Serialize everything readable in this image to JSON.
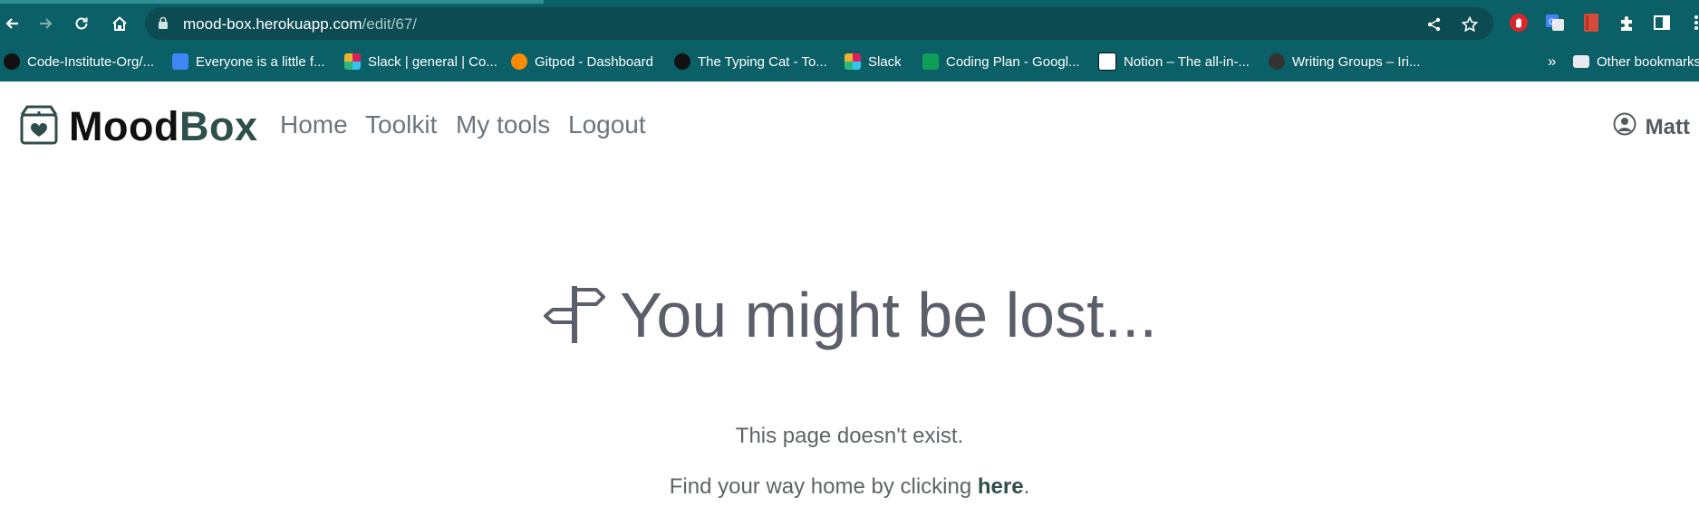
{
  "browser": {
    "url_host": "mood-box.herokuapp.com",
    "url_path": "/edit/67/",
    "bookmarks": [
      {
        "label": "Code-Institute-Org/...",
        "icon": "github-icon"
      },
      {
        "label": "Everyone is a little f...",
        "icon": "google-docs-icon"
      },
      {
        "label": "Slack | general | Co...",
        "icon": "slack-icon"
      },
      {
        "label": "Gitpod - Dashboard",
        "icon": "gitpod-icon"
      },
      {
        "label": "The Typing Cat - To...",
        "icon": "paw-icon"
      },
      {
        "label": "Slack",
        "icon": "slack-icon"
      },
      {
        "label": "Coding Plan - Googl...",
        "icon": "google-sheets-icon"
      },
      {
        "label": "Notion – The all-in-...",
        "icon": "notion-icon"
      },
      {
        "label": "Writing Groups – Iri...",
        "icon": "writing-icon"
      }
    ],
    "overflow_label": "»",
    "other_bookmarks": "Other bookmarks"
  },
  "site": {
    "brand_part1": "Mood",
    "brand_part2": "Box",
    "nav": [
      "Home",
      "Toolkit",
      "My tools",
      "Logout"
    ],
    "user_name": "Matt"
  },
  "content": {
    "headline": "You might be lost...",
    "message": "This page doesn't exist.",
    "link_prefix": "Find your way home by clicking ",
    "link_text": "here",
    "link_suffix": "."
  },
  "colors": {
    "chrome_bg": "#0b5f66",
    "brand_accent": "#2f4f4a",
    "muted_text": "#6c757d"
  }
}
